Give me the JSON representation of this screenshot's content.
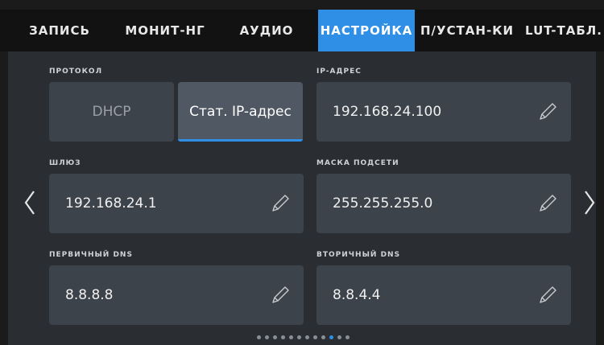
{
  "tabs": [
    {
      "label": "ЗАПИСЬ"
    },
    {
      "label": "МОНИТ-НГ"
    },
    {
      "label": "АУДИО"
    },
    {
      "label": "НАСТРОЙКА"
    },
    {
      "label": "П/УСТАН-КИ"
    },
    {
      "label": "LUT-ТАБЛ."
    }
  ],
  "active_tab": "НАСТРОЙКА",
  "protocol": {
    "label": "ПРОТОКОЛ",
    "options": [
      "DHCP",
      "Стат. IP-адрес"
    ],
    "selected": "Стат. IP-адрес"
  },
  "ip": {
    "label": "IP-АДРЕС",
    "value": "192.168.24.100"
  },
  "gateway": {
    "label": "ШЛЮЗ",
    "value": "192.168.24.1"
  },
  "subnet": {
    "label": "МАСКА ПОДСЕТИ",
    "value": "255.255.255.0"
  },
  "dns1": {
    "label": "ПЕРВИЧНЫЙ DNS",
    "value": "8.8.8.8"
  },
  "dns2": {
    "label": "ВТОРИЧНЫЙ DNS",
    "value": "8.8.4.4"
  },
  "pagination": {
    "total": 12,
    "current": 10
  },
  "icons": {
    "edit": "pencil-icon",
    "prev": "chevron-left-icon",
    "next": "chevron-right-icon"
  },
  "colors": {
    "accent": "#2f8fe6",
    "field": "#3d434b",
    "panel": "#2a2d31"
  }
}
